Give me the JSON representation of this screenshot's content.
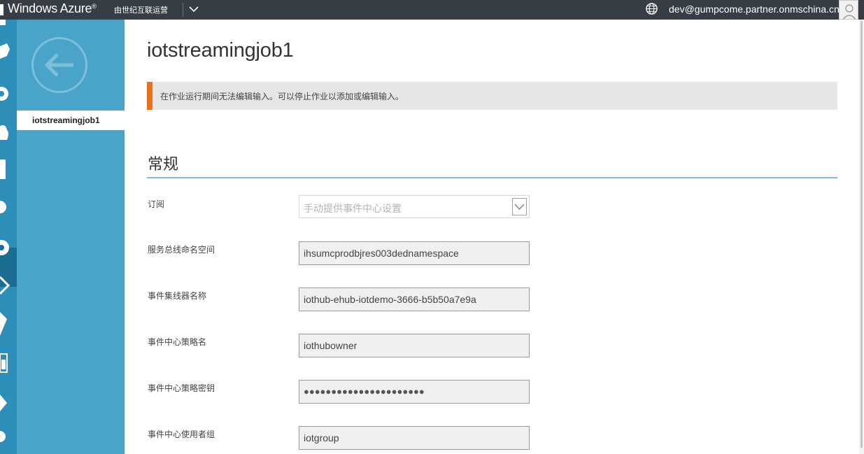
{
  "topbar": {
    "brand": "Windows Azure",
    "brand_mark": "®",
    "operator": "由世纪互联运营",
    "user_email": "dev@gumpcome.partner.onmschina.cn",
    "icons": [
      "chevron-down-icon",
      "globe-icon",
      "avatar-icon"
    ]
  },
  "rail": {
    "icons": [
      "service-icon",
      "network-icon",
      "gear-icon",
      "cloud-icon",
      "storage-icon",
      "globe-icon",
      "stream-analytics-icon",
      "arrow-icon",
      "tag-icon",
      "calendar-icon",
      "play-icon",
      "settings-icon"
    ],
    "selected": "stream-analytics-icon"
  },
  "blade": {
    "back_icon": "back-arrow-icon",
    "item_label": "iotstreamingjob1"
  },
  "main": {
    "title": "iotstreamingjob1",
    "notice": "在作业运行期间无法编辑输入。可以停止作业以添加或编辑输入。",
    "section_title": "常规",
    "fields": {
      "subscription": {
        "label": "订阅",
        "value": "手动提供事件中心设置"
      },
      "namespace": {
        "label": "服务总线命名空间",
        "value": "ihsumcprodbjres003dednamespace"
      },
      "hub_name": {
        "label": "事件集线器名称",
        "value": "iothub-ehub-iotdemo-3666-b5b50a7e9a"
      },
      "policy_name": {
        "label": "事件中心策略名",
        "value": "iothubowner"
      },
      "policy_key": {
        "label": "事件中心策略密钥",
        "value": "●●●●●●●●●●●●●●●●●●●●●●"
      },
      "consumer_group": {
        "label": "事件中心使用者组",
        "value": "iotgroup"
      }
    }
  },
  "colors": {
    "topbar": "#373d45",
    "rail": "#2d8fb8",
    "blade": "#4aa3c8",
    "notice_accent": "#e8701a",
    "section_rule": "#87bad6"
  }
}
